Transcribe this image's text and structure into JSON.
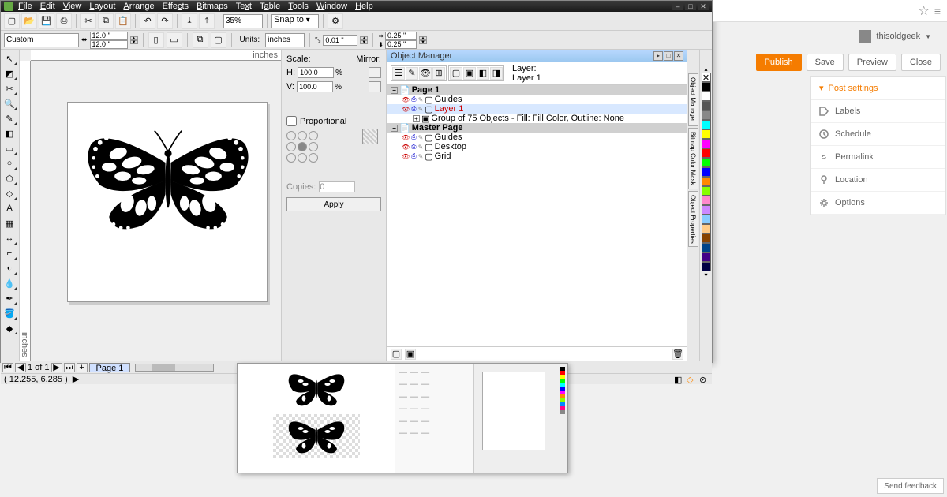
{
  "menubar": [
    "File",
    "Edit",
    "View",
    "Layout",
    "Arrange",
    "Effects",
    "Bitmaps",
    "Text",
    "Table",
    "Tools",
    "Window",
    "Help"
  ],
  "toolbar": {
    "zoom": "35%",
    "snap_label": "Snap to"
  },
  "props": {
    "custom": "Custom",
    "width": "12.0 \"",
    "height": "12.0 \"",
    "units_label": "Units:",
    "units": "inches",
    "nudge": "0.01 \"",
    "dupx": "0.25 \"",
    "dupy": "0.25 \"",
    "ruler_unit": "inches"
  },
  "scale": {
    "scale_label": "Scale:",
    "mirror_label": "Mirror:",
    "h_label": "H:",
    "v_label": "V:",
    "h": "100.0",
    "v": "100.0",
    "proportional": "Proportional",
    "copies_label": "Copies:",
    "copies": "0",
    "apply": "Apply"
  },
  "obj_mgr": {
    "title": "Object Manager",
    "layer_label": "Layer:",
    "layer_name": "Layer 1",
    "tree": [
      {
        "type": "page",
        "label": "Page 1",
        "expanded": true
      },
      {
        "type": "layer",
        "label": "Guides",
        "depth": 1
      },
      {
        "type": "layer",
        "label": "Layer 1",
        "depth": 1,
        "red": true,
        "sel": true
      },
      {
        "type": "group",
        "label": "Group of 75 Objects - Fill: Fill Color, Outline: None",
        "depth": 2
      },
      {
        "type": "page",
        "label": "Master Page",
        "expanded": true
      },
      {
        "type": "layer",
        "label": "Guides",
        "depth": 1
      },
      {
        "type": "layer",
        "label": "Desktop",
        "depth": 1
      },
      {
        "type": "layer",
        "label": "Grid",
        "depth": 1
      }
    ]
  },
  "dockers": [
    "Object Manager",
    "Bitmap Color Mask",
    "Object Properties"
  ],
  "palette": [
    "#000000",
    "#ffffff",
    "#555555",
    "#888888",
    "#00ffff",
    "#ffff00",
    "#ff00ff",
    "#ff0000",
    "#00ff00",
    "#0000ff",
    "#ff8800",
    "#88ff00",
    "#ff88cc",
    "#cc88ff",
    "#88ccff",
    "#ffcc88",
    "#884400",
    "#004488",
    "#440088",
    "#000044"
  ],
  "page_nav": {
    "counter": "1 of 1",
    "tab": "Page 1"
  },
  "status": {
    "coords": "( 12.255, 6.285 )"
  },
  "blogger": {
    "user": "thisoldgeek",
    "publish": "Publish",
    "save": "Save",
    "preview": "Preview",
    "close": "Close",
    "header": "Post settings",
    "items": [
      "Labels",
      "Schedule",
      "Permalink",
      "Location",
      "Options"
    ]
  },
  "feedback": "Send feedback"
}
